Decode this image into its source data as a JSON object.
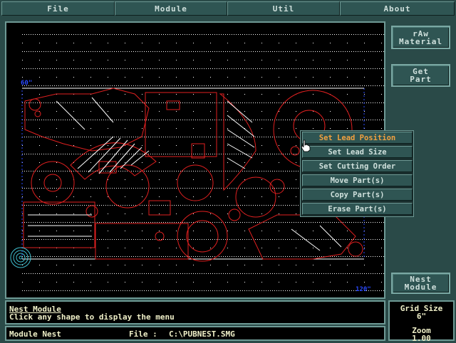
{
  "menubar": {
    "items": [
      {
        "label": "File"
      },
      {
        "label": "Module"
      },
      {
        "label": "Util"
      },
      {
        "label": "About"
      }
    ]
  },
  "sidebar": {
    "raw_material_label": "rAw\nMaterial",
    "get_part_label": "Get\nPart",
    "nest_module_label": "Nest\nModule"
  },
  "canvas": {
    "label_top_left": "60\"",
    "label_bottom_right": "120\""
  },
  "context_menu": {
    "items": [
      {
        "label": "Set Lead Position",
        "selected": true
      },
      {
        "label": "Set Lead Size",
        "selected": false
      },
      {
        "label": "Set Cutting Order",
        "selected": false
      },
      {
        "label": "Move Part(s)",
        "selected": false
      },
      {
        "label": "Copy Part(s)",
        "selected": false
      },
      {
        "label": "Erase Part(s)",
        "selected": false
      }
    ]
  },
  "message": {
    "title": "Nest Module",
    "text": "Click any shape to display the menu"
  },
  "status": {
    "module": "Module Nest",
    "file_label": "File : ",
    "file_path": "C:\\PUBNEST.SMG"
  },
  "grid_panel": {
    "grid_size_label": "Grid Size",
    "grid_size_value": "6\"",
    "zoom_label": "Zoom",
    "zoom_value": "1.00"
  },
  "colors": {
    "part_outline": "#e02020",
    "grid_dot": "#ffffff",
    "lead_lines": "#ffffff",
    "material_boundary": "#2a4aff",
    "menu_selected_text": "#f0a040"
  },
  "icons": {
    "cursor": "hand-pointer-icon"
  }
}
